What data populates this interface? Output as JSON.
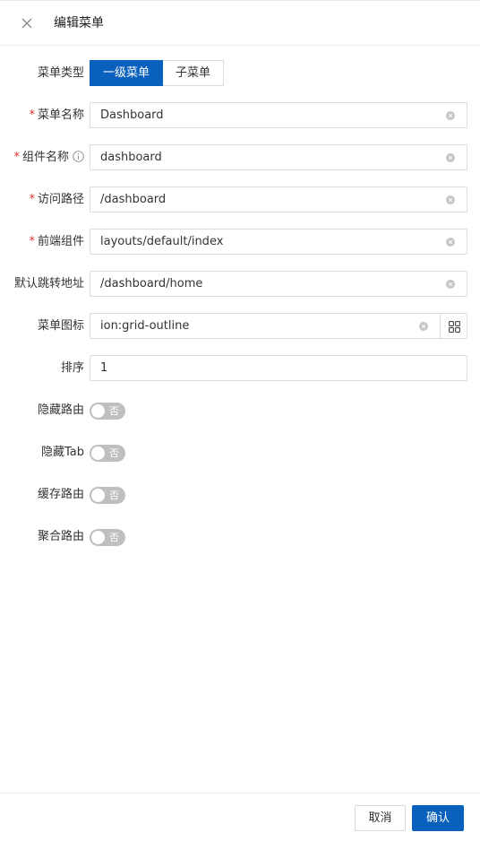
{
  "drawer": {
    "title": "编辑菜单"
  },
  "form": {
    "menu_type": {
      "label": "菜单类型",
      "options": [
        "一级菜单",
        "子菜单"
      ],
      "selected": "一级菜单"
    },
    "menu_name": {
      "label": "菜单名称",
      "required": true,
      "value": "Dashboard"
    },
    "component_name": {
      "label": "组件名称",
      "required": true,
      "value": "dashboard"
    },
    "access_path": {
      "label": "访问路径",
      "required": true,
      "value": "/dashboard"
    },
    "frontend_component": {
      "label": "前端组件",
      "required": true,
      "value": "layouts/default/index"
    },
    "default_redirect": {
      "label": "默认跳转地址",
      "value": "/dashboard/home"
    },
    "menu_icon": {
      "label": "菜单图标",
      "value": "ion:grid-outline"
    },
    "sort": {
      "label": "排序",
      "value": "1"
    },
    "hide_route": {
      "label": "隐藏路由",
      "state": "否"
    },
    "hide_tab": {
      "label": "隐藏Tab",
      "state": "否"
    },
    "cache_route": {
      "label": "缓存路由",
      "state": "否"
    },
    "aggregate_route": {
      "label": "聚合路由",
      "state": "否"
    }
  },
  "footer": {
    "cancel_label": "取消",
    "confirm_label": "确认"
  },
  "colors": {
    "primary": "#0960bd",
    "required": "#e0342f",
    "switch_off": "#bfbfbf"
  },
  "required_mark": "*"
}
